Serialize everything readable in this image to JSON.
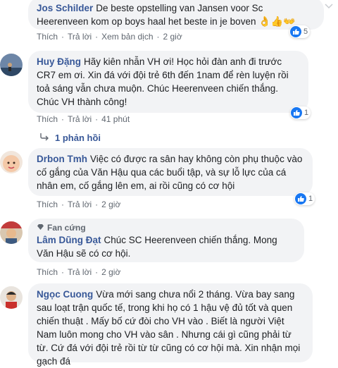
{
  "comments": [
    {
      "author": "Jos Schilder",
      "text": "De beste opstelling van Jansen voor Sc Heerenveen kom op boys haal het beste in je boven",
      "emojis": [
        "👌",
        "👍",
        "👐"
      ],
      "actions": {
        "like": "Thích",
        "reply": "Trả lời",
        "translate": "Xem bản dịch",
        "time": "2 giờ"
      },
      "like_count": "5"
    },
    {
      "author": "Huy Đặng",
      "text": "Hãy kiên nhẫn VH ơi! Học hỏi đàn anh đi trước CR7 em ơi. Xin đá với đội trẻ 6th đến 1nam để rèn luyện rồi toả sáng vẫn chưa muộn. Chúc Heerenveen chiến thắng. Chúc VH thành công!",
      "actions": {
        "like": "Thích",
        "reply": "Trả lời",
        "time": "41 phút"
      },
      "like_count": "1",
      "replies_label": "1 phản hồi"
    },
    {
      "author": "Drbon Tmh",
      "text": "Việc có được ra sân hay không còn phụ thuộc vào cố gắng của Văn Hậu qua các buổi tập, và sự lỗ lực của cá nhân em, cố gắng lên em, ai rồi cũng có cơ hội",
      "actions": {
        "like": "Thích",
        "reply": "Trả lời",
        "time": "2 giờ"
      },
      "like_count": "1"
    },
    {
      "badge": "Fan cứng",
      "author": "Lâm Dũng Đạt",
      "text": "Chúc SC Heerenveen chiến thắng. Mong Văn Hậu sẽ có cơ hội.",
      "actions": {
        "like": "Thích",
        "reply": "Trả lời",
        "time": "2 giờ"
      }
    },
    {
      "author": "Ngọc Cuong",
      "text": "Vừa mới sang chưa nổi 2 tháng. Vừa bay sang sau loạt trận quốc tế, trong khi họ có 1 hậu vệ đủ tốt và quen chiến thuật . Mấy bố cứ đòi cho VH vào . Biết là người Việt Nam luôn mong cho VH vào sân . Nhưng cái gì cũng phải từ từ. Cứ đá với đội trẻ rồi từ từ cũng có cơ hội mà. Xin nhận mọi gạch đá"
    }
  ],
  "colors": {
    "link": "#385898",
    "bubble": "#f2f3f5",
    "like": "#1877f2"
  }
}
